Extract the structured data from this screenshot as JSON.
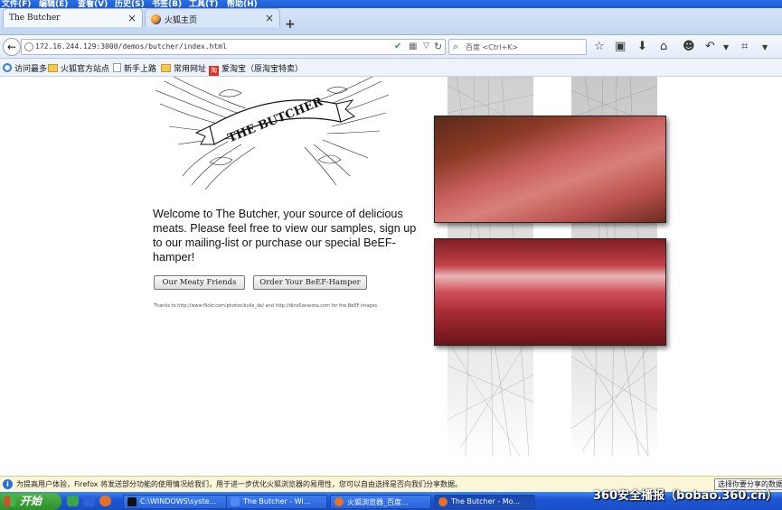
{
  "menubar": {
    "items": [
      "文件(F)",
      "编辑(E)",
      "查看(V)",
      "历史(S)",
      "书签(B)",
      "工具(T)",
      "帮助(H)"
    ]
  },
  "tabs": [
    {
      "label": "The Butcher",
      "active": true
    },
    {
      "label": "火狐主页",
      "active": false
    }
  ],
  "newtab_glyph": "+",
  "navbar": {
    "url": "172.16.244.129:3000/demos/butcher/index.html",
    "search_placeholder": "百度 <Ctrl+K>"
  },
  "bookmarks": [
    {
      "label": "访问最多",
      "icon": "gear-icon"
    },
    {
      "label": "火狐官方站点",
      "icon": "folder-icon"
    },
    {
      "label": "新手上路",
      "icon": "page-icon"
    },
    {
      "label": "常用网址",
      "icon": "folder-icon"
    },
    {
      "label": "爱淘宝（原淘宝特卖）",
      "icon": "taobao-icon",
      "badge": "淘"
    }
  ],
  "page": {
    "logo_text": "THE BUTCHER",
    "welcome": "Welcome to The Butcher, your source of delicious meats. Please feel free to view our samples, sign up to our mailing-list or purchase our special BeEF-hamper!",
    "buttons": {
      "friends": "Our Meaty Friends",
      "order": "Order Your BeEF-Hamper"
    },
    "thanks": "Thanks to http://www.flickr.com/photos/bulle_de/ and http://dine5arasota.com for the BeEF images"
  },
  "notification": {
    "text": "为提高用户体验，Firefox 将发送部分功能的使用情况给我们，用于进一步优化火狐浏览器的易用性，您可以自由选择是否向我们分享数据。",
    "share_button": "选择你要分享的数据"
  },
  "taskbar": {
    "start": "开始",
    "tasks": [
      {
        "label": "C:\\WINDOWS\\syste...",
        "active": false
      },
      {
        "label": "The Butcher - Wi...",
        "active": false
      },
      {
        "label": "火狐浏览器_百度...",
        "active": false
      },
      {
        "label": "The Butcher - Mo...",
        "active": true
      }
    ]
  },
  "watermark": "360安全播报（bobao.360.cn）",
  "colors": {
    "titlebar_blue": "#1f5ad0",
    "taskbar_blue": "#1d57d6",
    "start_green": "#3a9f36",
    "notify_bg": "#fbf6d8"
  }
}
